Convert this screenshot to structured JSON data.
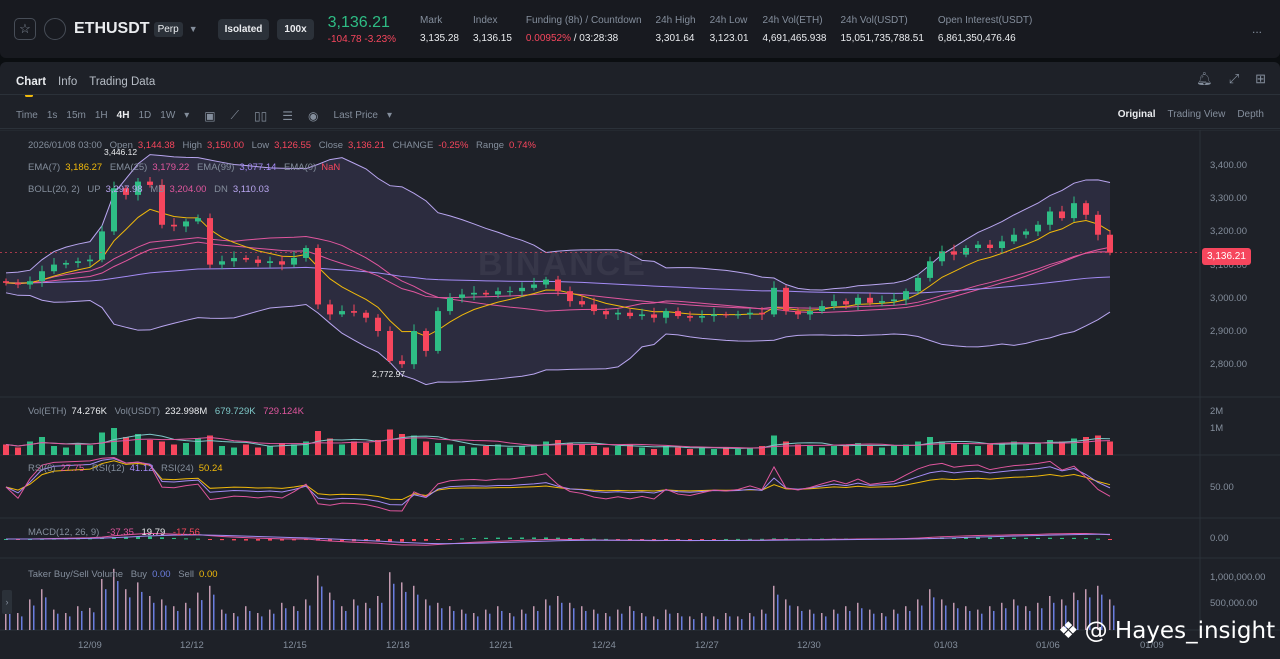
{
  "header": {
    "symbol": "ETHUSDT",
    "contract": "Perp",
    "margin_mode": "Isolated",
    "leverage": "100x",
    "last_price": "3,136.21",
    "change": "-104.78",
    "change_pct": "-3.23%",
    "stats": [
      {
        "label": "Mark",
        "value": "3,135.28"
      },
      {
        "label": "Index",
        "value": "3,136.15"
      },
      {
        "label": "Funding (8h) / Countdown",
        "value": "0.00952%",
        "extra": " / 03:28:38"
      },
      {
        "label": "24h High",
        "value": "3,301.64"
      },
      {
        "label": "24h Low",
        "value": "3,123.01"
      },
      {
        "label": "24h Vol(ETH)",
        "value": "4,691,465.938"
      },
      {
        "label": "24h Vol(USDT)",
        "value": "15,051,735,788.51"
      },
      {
        "label": "Open Interest(USDT)",
        "value": "6,861,350,476.46"
      }
    ],
    "more": "..."
  },
  "tabs": [
    "Chart",
    "Info",
    "Trading Data"
  ],
  "toolbar": {
    "time_label": "Time",
    "intervals": [
      "1s",
      "15m",
      "1H",
      "4H",
      "1D",
      "1W"
    ],
    "active_interval": "4H",
    "price_type": "Last Price"
  },
  "views": [
    "Original",
    "Trading View",
    "Depth"
  ],
  "ohlc": {
    "date": "2026/01/08 03:00",
    "open_l": "Open",
    "open": "3,144.38",
    "high_l": "High",
    "high": "3,150.00",
    "low_l": "Low",
    "low": "3,126.55",
    "close_l": "Close",
    "close": "3,136.21",
    "change_l": "CHANGE",
    "change": "-0.25%",
    "range_l": "Range",
    "range": "0.74%"
  },
  "ema": {
    "e7_l": "EMA(7)",
    "e7": "3,186.27",
    "e25_l": "EMA(25)",
    "e25": "3,179.22",
    "e99_l": "EMA(99)",
    "e99": "3,077.14",
    "e0_l": "EMA(0)",
    "e0": "NaN"
  },
  "boll": {
    "label": "BOLL(20, 2)",
    "up_l": "UP",
    "up": "3,297.98",
    "mb_l": "MB",
    "mb": "3,204.00",
    "dn_l": "DN",
    "dn": "3,110.03"
  },
  "vol": {
    "eth_l": "Vol(ETH)",
    "eth": "74.276K",
    "usdt_l": "Vol(USDT)",
    "usdt": "232.998M",
    "ma1": "679.729K",
    "ma2": "729.124K"
  },
  "rsi": {
    "r6_l": "RSI(6)",
    "r6": "27.75",
    "r12_l": "RSI(12)",
    "r12": "41.12",
    "r24_l": "RSI(24)",
    "r24": "50.24"
  },
  "macd": {
    "label": "MACD(12, 26, 9)",
    "dif": "-37.35",
    "dea": "19.79",
    "hist": "-17.56"
  },
  "taker": {
    "label": "Taker Buy/Sell Volume",
    "buy_l": "Buy",
    "buy": "0.00",
    "sell_l": "Sell",
    "sell": "0.00"
  },
  "price_axis": [
    "3,400.00",
    "3,300.00",
    "3,200.00",
    "3,100.00",
    "3,000.00",
    "2,900.00",
    "2,800.00"
  ],
  "vol_axis": [
    "2M",
    "1M"
  ],
  "rsi_axis": "50.00",
  "macd_axis": "0.00",
  "taker_axis": [
    "1,000,000.00",
    "500,000.00"
  ],
  "x_axis": [
    "12/09",
    "12/12",
    "12/15",
    "12/18",
    "12/21",
    "12/24",
    "12/27",
    "12/30",
    "01/03",
    "01/06",
    "01/09"
  ],
  "current_price_tag": "3,136.21",
  "high_mark": "3,446.12",
  "low_mark": "2,772.97",
  "watermark": "BINANCE",
  "overlay_credit": "@ Hayes_insight",
  "colors": {
    "up": "#2ebd85",
    "down": "#f6465d",
    "ema7": "#f0b90b",
    "ema25": "#e0569e",
    "ema99": "#a48bf5",
    "boll": "#b9a6f0"
  },
  "chart_data": {
    "type": "candlestick",
    "interval": "4H",
    "closes": [
      3045,
      3040,
      3050,
      3080,
      3100,
      3105,
      3110,
      3115,
      3200,
      3330,
      3310,
      3350,
      3340,
      3220,
      3215,
      3230,
      3240,
      3100,
      3110,
      3120,
      3115,
      3105,
      3110,
      3100,
      3120,
      3150,
      2980,
      2950,
      2960,
      2955,
      2940,
      2900,
      2810,
      2800,
      2900,
      2840,
      2960,
      3000,
      3010,
      3015,
      3010,
      3020,
      3020,
      3030,
      3040,
      3055,
      3020,
      2990,
      2980,
      2960,
      2950,
      2955,
      2945,
      2950,
      2940,
      2960,
      2945,
      2940,
      2945,
      2950,
      2948,
      2950,
      2955,
      2950,
      3030,
      2960,
      2950,
      2960,
      2975,
      2990,
      2980,
      3000,
      2985,
      2990,
      2995,
      3020,
      3060,
      3110,
      3140,
      3130,
      3150,
      3160,
      3150,
      3170,
      3190,
      3200,
      3220,
      3260,
      3240,
      3285,
      3250,
      3190,
      3136
    ],
    "volumes_k": [
      700,
      500,
      900,
      1200,
      600,
      500,
      700,
      650,
      1500,
      1800,
      1200,
      1400,
      1000,
      900,
      700,
      800,
      1100,
      1300,
      600,
      500,
      700,
      500,
      600,
      800,
      700,
      900,
      1600,
      1100,
      700,
      900,
      800,
      1000,
      1700,
      1400,
      1300,
      900,
      800,
      700,
      600,
      500,
      600,
      700,
      500,
      600,
      700,
      900,
      1000,
      800,
      700,
      600,
      500,
      600,
      700,
      500,
      400,
      600,
      500,
      400,
      500,
      400,
      500,
      400,
      500,
      600,
      1300,
      900,
      700,
      600,
      500,
      600,
      700,
      800,
      600,
      500,
      600,
      700,
      900,
      1200,
      900,
      800,
      700,
      600,
      700,
      800,
      900,
      700,
      800,
      1000,
      900,
      1100,
      1200,
      1300,
      900
    ],
    "ylim": [
      2750,
      3450
    ]
  }
}
